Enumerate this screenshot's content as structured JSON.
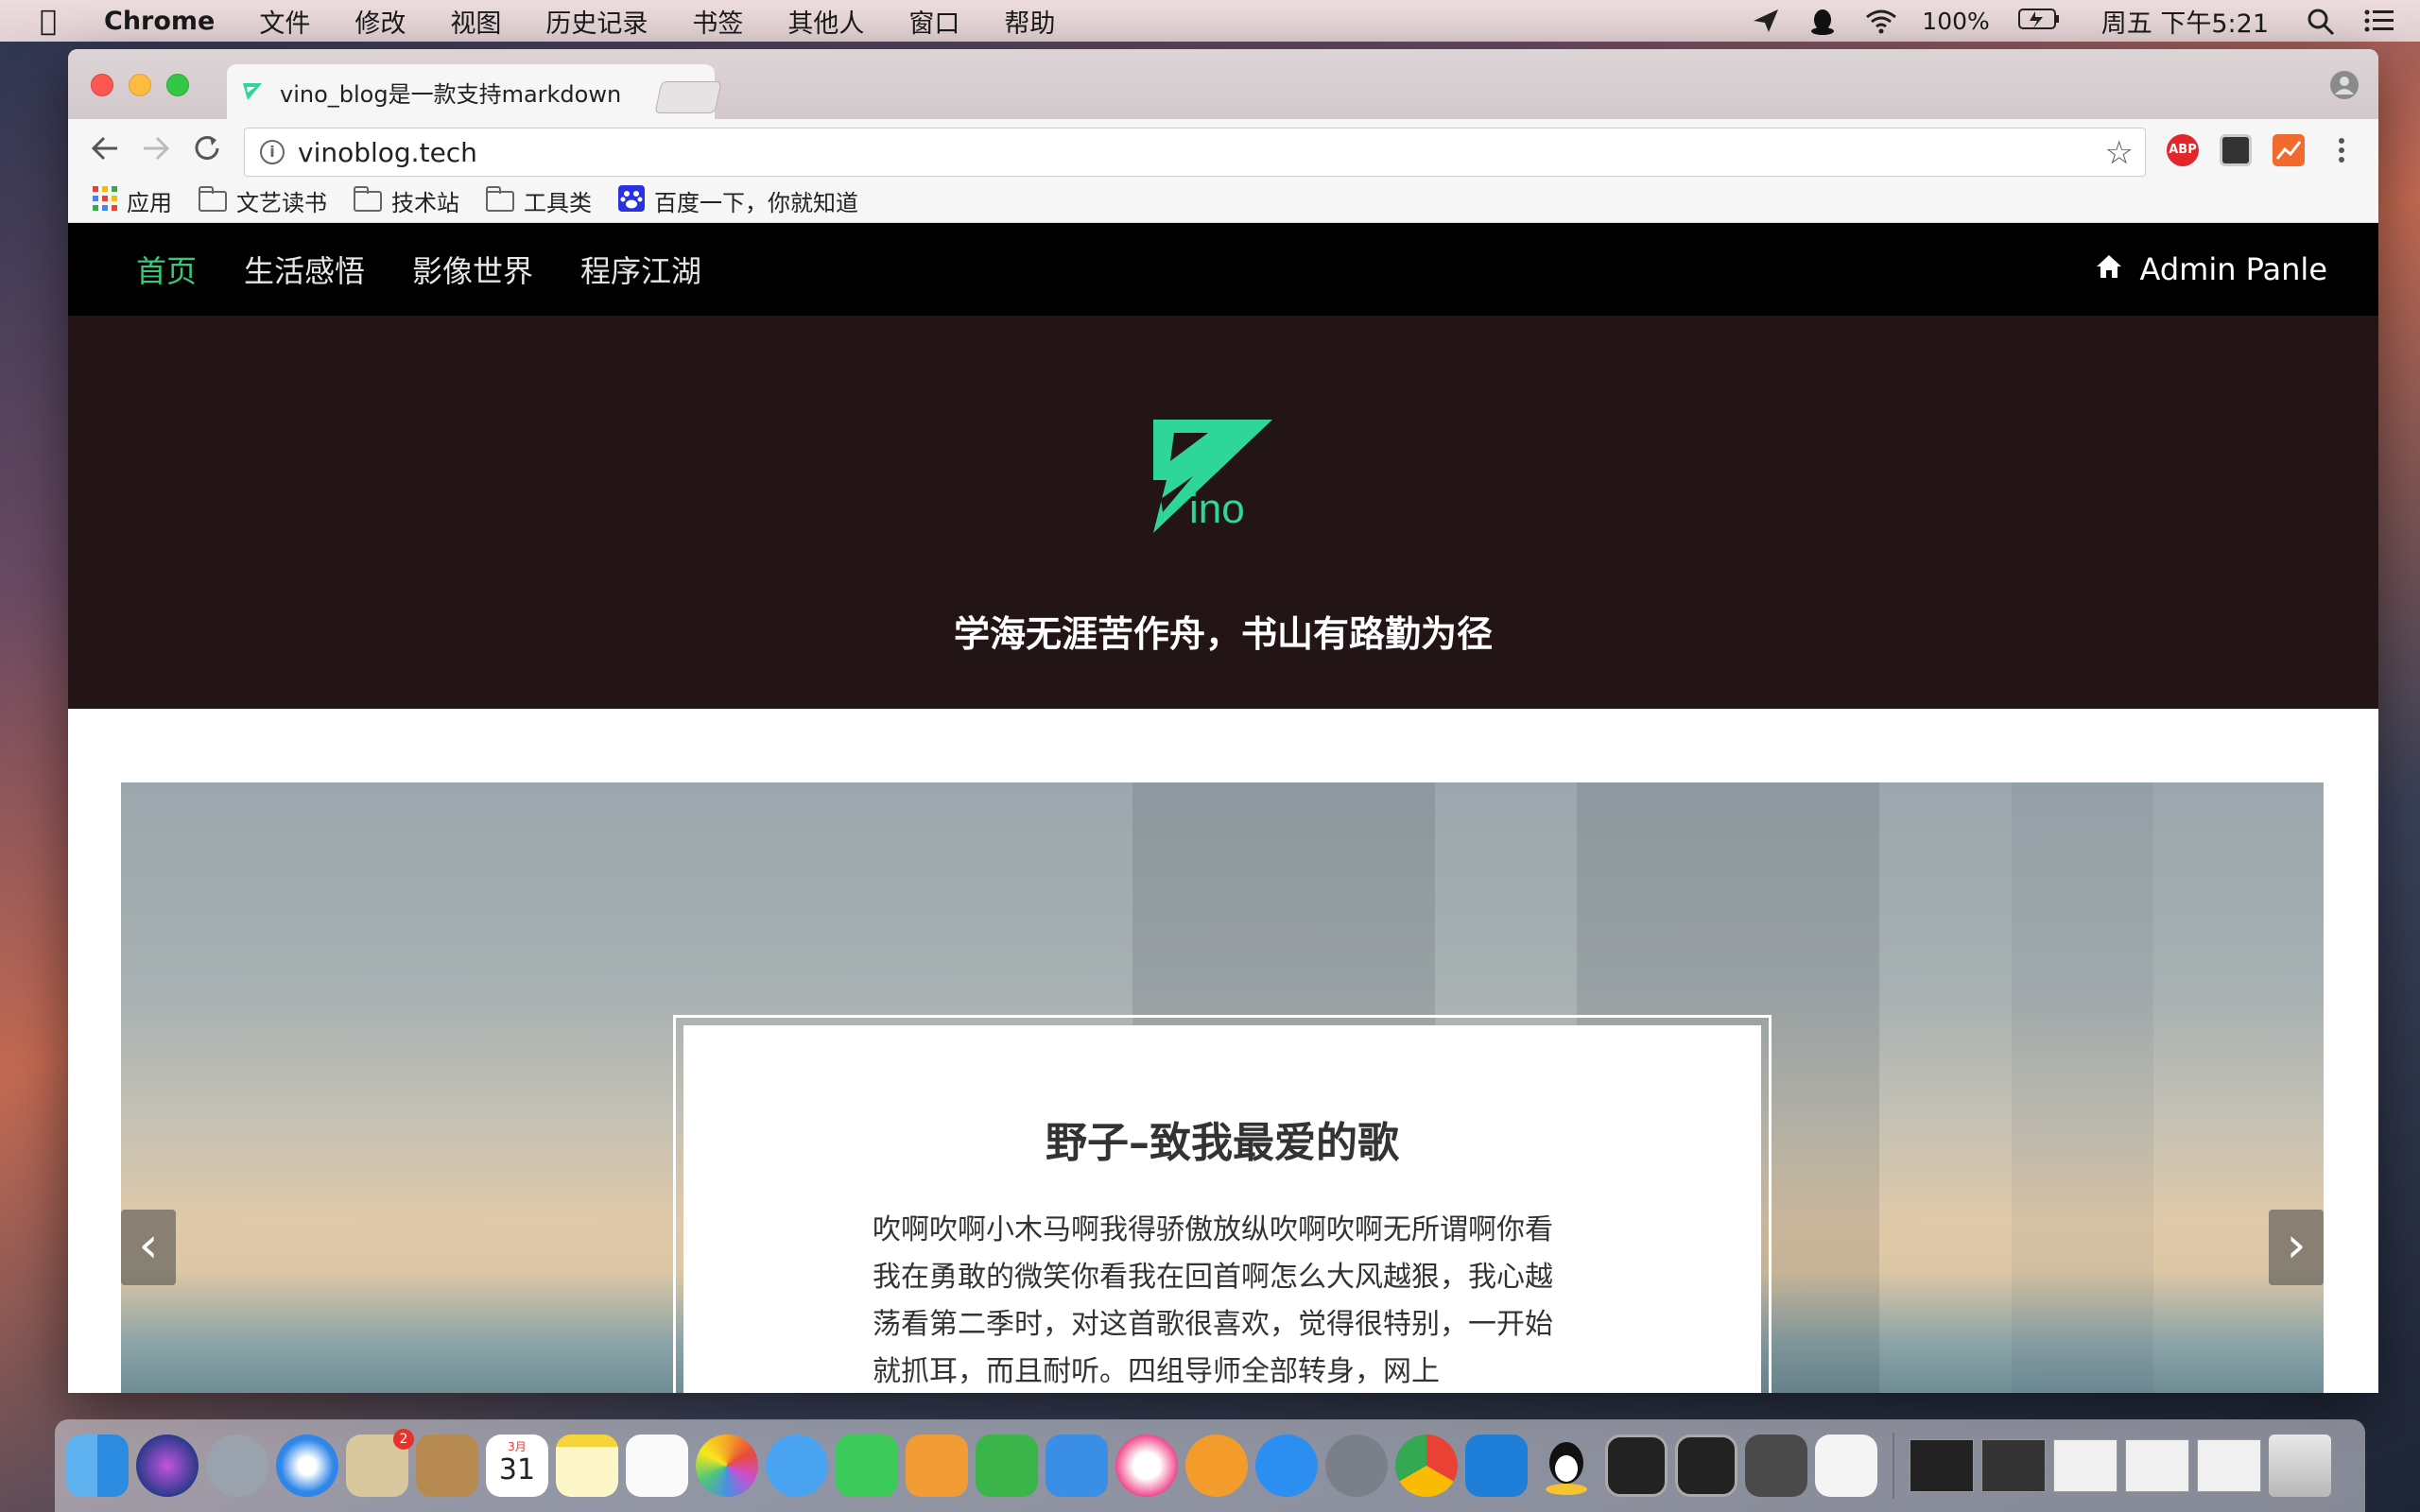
{
  "menubar": {
    "app": "Chrome",
    "items": [
      "文件",
      "修改",
      "视图",
      "历史记录",
      "书签",
      "其他人",
      "窗口",
      "帮助"
    ],
    "battery": "100%",
    "clock": "周五 下午5:21"
  },
  "browser": {
    "tab_title": "vino_blog是一款支持markdown",
    "url": "vinoblog.tech",
    "bookmarks": [
      "应用",
      "文艺读书",
      "技术站",
      "工具类",
      "百度一下，你就知道"
    ],
    "abp_label": "ABP"
  },
  "site": {
    "nav": [
      "首页",
      "生活感悟",
      "影像世界",
      "程序江湖"
    ],
    "admin_label": "Admin Panle",
    "logo_text": "ino",
    "slogan": "学海无涯苦作舟，书山有路勤为径",
    "card_title": "野子–致我最爱的歌",
    "card_text": "吹啊吹啊小木马啊我得骄傲放纵吹啊吹啊无所谓啊你看我在勇敢的微笑你看我在回首啊怎么大风越狠，我心越荡看第二季时，对这首歌很喜欢，觉得很特别，一开始就抓耳，而且耐听。四组导师全部转身，网上",
    "prev": "‹",
    "next": "›"
  },
  "dock": {
    "badge": "2",
    "calendar_month": "3月",
    "calendar_day": "31"
  },
  "colors": {
    "nav_active": "#35c97a",
    "hero_bg": "#231416",
    "logo_accent": "#2fd69a"
  }
}
